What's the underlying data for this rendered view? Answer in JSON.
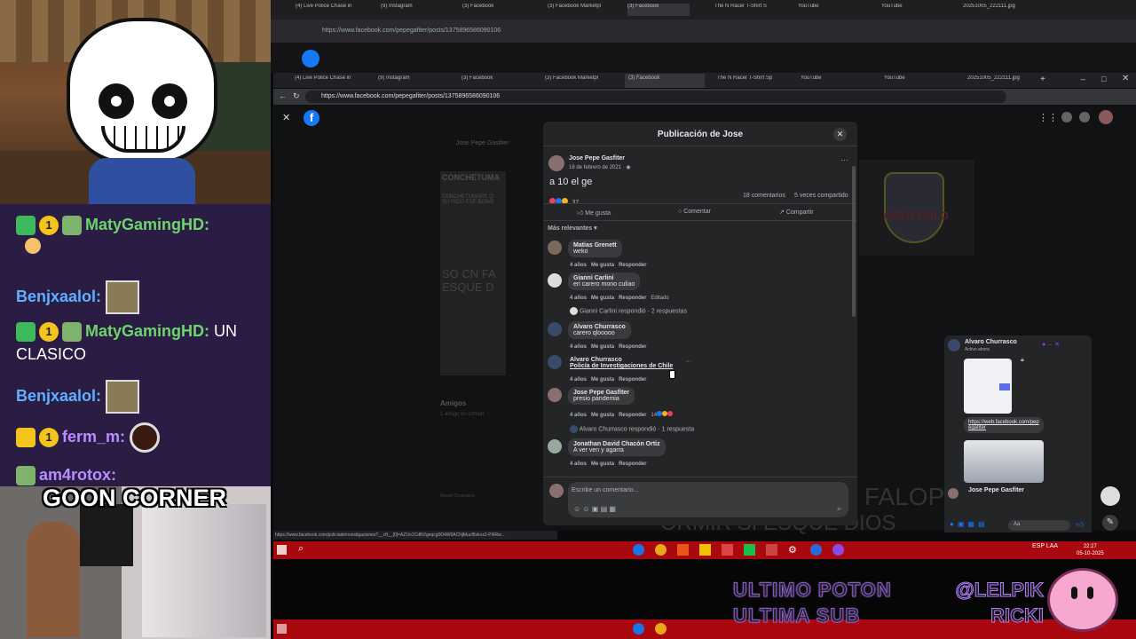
{
  "stream_chat": {
    "messages": [
      {
        "user": "MatyGamingHD:",
        "text": ""
      },
      {
        "user": "Benjxaalol:",
        "text": ""
      },
      {
        "user": "MatyGamingHD:",
        "text": "UN CLASICO"
      },
      {
        "user": "Benjxaalol:",
        "text": ""
      },
      {
        "user": "ferm_m:",
        "text": ""
      },
      {
        "user": "am4rotox:",
        "text": ""
      }
    ],
    "badge_count": "1",
    "overlay_text": "GOON CORNER"
  },
  "outer_browser": {
    "tabs": [
      "(4) Live Police Chase in",
      "(9) Instagram",
      "(3) Facebook",
      "(3) Facebook Marketpl",
      "(3) Facebook",
      "The N Racer T-Shirt S",
      "YouTube",
      "YouTube",
      "20251005_222111.jpg"
    ],
    "url": "https://www.facebook.com/pepegafiter/posts/1375896586090106"
  },
  "inner_browser": {
    "tabs": [
      "(4) Live Police Chase in",
      "(9) Instagram",
      "(3) Facebook",
      "(3) Facebook Marketpl",
      "(3) Facebook",
      "The N Racer T-Shirt Sp",
      "YouTube",
      "YouTube",
      "20251005_222111.jpg"
    ],
    "url": "https://www.facebook.com/pepegafiter/posts/1375896586090106"
  },
  "background_post": {
    "author": "Jose Pepe Gasfiter",
    "snippet_lines": [
      "CONCHETUMA",
      "CONCHETUMARE Q",
      "SU RICO ESE BERAI",
      "SO CN FA",
      "ESQUE D"
    ],
    "friends_label": "Amigos",
    "friends_sub": "1 amigo en común",
    "friend_name": "Alvaro Churrasco",
    "team_name": "COLO COLO",
    "faded_bottom": "ORMIR SI ESQUE DIOS",
    "faded_right": "FALOP"
  },
  "modal": {
    "title": "Publicación de Jose",
    "author": "Jose Pepe Gasfiter",
    "date": "18 de febrero de 2021 · ",
    "post_text": "a 10 el ge",
    "reaction_count": "37",
    "comments_count": "18 comentarios",
    "shares_count": "5 veces compartido",
    "actions": {
      "like": "Me gusta",
      "comment": "Comentar",
      "share": "Compartir"
    },
    "sort_label": "Más relevantes",
    "comments": [
      {
        "author": "Matias Grenett",
        "text": "weko",
        "time": "4 años",
        "like": "Me gusta",
        "reply": "Responder",
        "extra": ""
      },
      {
        "author": "Gianni Carlini",
        "text": "eri carero mono culiao",
        "time": "4 años",
        "like": "Me gusta",
        "reply": "Responder",
        "extra": "Editado"
      },
      {
        "author": "Alvaro Churrasco",
        "text": "carero qlooooo",
        "time": "4 años",
        "like": "Me gusta",
        "reply": "Responder",
        "extra": ""
      },
      {
        "author": "Alvaro Churrasco",
        "text": "Policía de Investigaciones de Chile",
        "time": "4 años",
        "like": "Me gusta",
        "reply": "Responder",
        "extra": ""
      },
      {
        "author": "Jose Pepe Gasfiter",
        "text": "presio pandemia",
        "time": "4 años",
        "like": "Me gusta",
        "reply": "Responder",
        "extra": "14"
      },
      {
        "author": "Jonathan David Chacón Ortiz",
        "text": "A ver ven y agarra",
        "time": "4 años",
        "like": "Me gusta",
        "reply": "Responder",
        "extra": ""
      }
    ],
    "replies": [
      "Gianni Carlini respondió · 2 respuestas",
      "Alvaro Churrasco respondió · 1 respuesta"
    ],
    "comment_placeholder": "Escribe un comentario..."
  },
  "messenger": {
    "name": "Alvaro Churrasco",
    "status": "Activo ahora",
    "link": "https://web.facebook.com/pepegafiter",
    "sender": "Jose Pepe Gasfiter",
    "input_placeholder": "Aa"
  },
  "status_url": "https://www.facebook.com/policiadeinvestigaciones?__cft__[0]=AZUo1Cdfh2geqcg0D4W0ACNjMucf6vkoz2-Pi6Rw...",
  "taskbar": {
    "lang": "ESP LAA",
    "time": "22:27",
    "date": "05-10-2025"
  },
  "stream_overlay": {
    "line1": "ULTIMO POTON",
    "line2": "ULTIMA SUB",
    "tag": "@LELPIK",
    "tag2": "RICKI"
  },
  "colors": {
    "facebook_blue": "#1877f2",
    "taskbar_red": "#a8080e",
    "chat_purple": "#2b1c44",
    "chat_green": "#6cd66c"
  }
}
